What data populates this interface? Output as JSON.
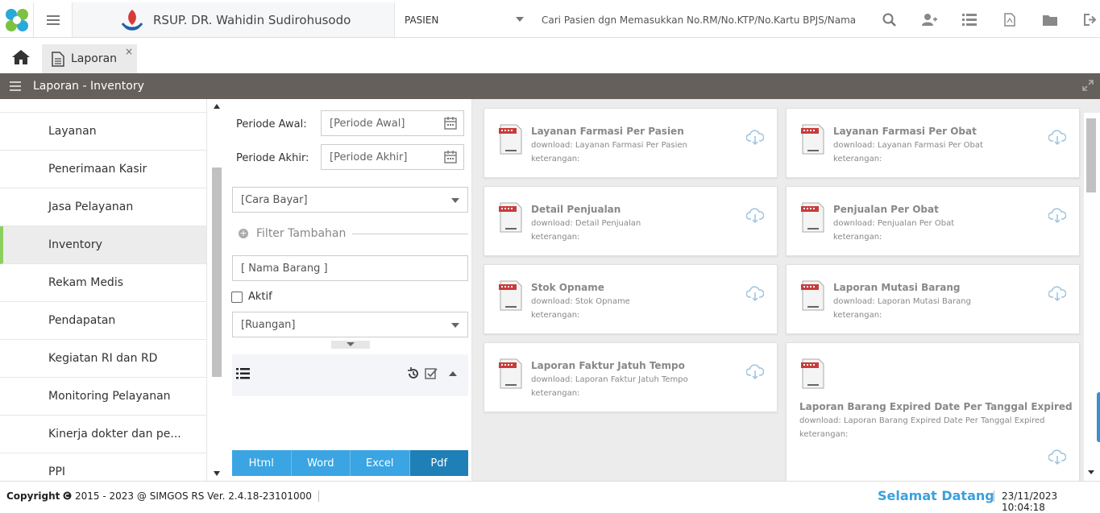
{
  "app": {
    "hospital_name": "RSUP. DR. Wahidin Sudirohusodo",
    "module": "PASIEN",
    "search_placeholder": "Cari Pasien dgn Memasukkan No.RM/No.KTP/No.Kartu BPJS/Nama"
  },
  "tabs": [
    {
      "label": "Laporan",
      "close": "×"
    }
  ],
  "header": {
    "title": "Laporan - Inventory"
  },
  "sidebar": {
    "items": [
      {
        "label": "Layanan"
      },
      {
        "label": "Penerimaan Kasir"
      },
      {
        "label": "Jasa Pelayanan"
      },
      {
        "label": "Inventory",
        "active": true
      },
      {
        "label": "Rekam Medis"
      },
      {
        "label": "Pendapatan"
      },
      {
        "label": "Kegiatan RI dan RD"
      },
      {
        "label": "Monitoring Pelayanan"
      },
      {
        "label": "Kinerja dokter dan pe..."
      },
      {
        "label": "PPI"
      }
    ]
  },
  "filters": {
    "periode_awal_label": "Periode Awal:",
    "periode_awal_placeholder": "[Periode Awal]",
    "periode_akhir_label": "Periode Akhir:",
    "periode_akhir_placeholder": "[Periode Akhir]",
    "cara_bayar": "[Cara Bayar]",
    "filter_tambahan": "Filter Tambahan",
    "nama_barang_placeholder": "[ Nama Barang ]",
    "aktif_label": "Aktif",
    "ruangan": "[Ruangan]",
    "export_buttons": [
      "Html",
      "Word",
      "Excel",
      "Pdf"
    ],
    "export_selected": "Pdf"
  },
  "reports": [
    {
      "title": "Layanan Farmasi Per Pasien",
      "download": "download: Layanan Farmasi Per Pasien",
      "note": "keterangan:"
    },
    {
      "title": "Layanan Farmasi Per Obat",
      "download": "download: Layanan Farmasi Per Obat",
      "note": "keterangan:"
    },
    {
      "title": "Detail Penjualan",
      "download": "download: Detail Penjualan",
      "note": "keterangan:"
    },
    {
      "title": "Penjualan Per Obat",
      "download": "download: Penjualan Per Obat",
      "note": "keterangan:"
    },
    {
      "title": "Stok Opname",
      "download": "download: Stok Opname",
      "note": "keterangan:"
    },
    {
      "title": "Laporan Mutasi Barang",
      "download": "download: Laporan Mutasi Barang",
      "note": "keterangan:"
    },
    {
      "title": "Laporan Faktur Jatuh Tempo",
      "download": "download: Laporan Faktur Jatuh Tempo",
      "note": "keterangan:"
    },
    {
      "title": "Laporan Barang Expired Date Per Tanggal Expired",
      "download": "download: Laporan Barang Expired Date Per Tanggal Expired",
      "note": "keterangan:"
    }
  ],
  "footer": {
    "copyright_label": "Copyright",
    "copyright_text": "2015 - 2023 @ SIMGOS RS Ver. 2.4.18-23101000",
    "welcome": "Selamat Datang",
    "datetime": "23/11/2023 10:04:18"
  },
  "colors": {
    "header_band": "#65605c",
    "accent_blue": "#3aa5e2",
    "active_marker": "#8bd05f"
  },
  "icons": [
    "app-logo-icon",
    "hamburger-icon",
    "hospital-emblem-icon",
    "search-icon",
    "add-user-icon",
    "list-icon",
    "pdf-file-icon",
    "folder-icon",
    "logout-icon",
    "home-icon",
    "document-icon",
    "expand-icon",
    "calendar-icon",
    "plus-circle-icon",
    "history-icon",
    "check-square-icon",
    "report-doc-icon",
    "cloud-download-icon",
    "copyright-icon"
  ]
}
